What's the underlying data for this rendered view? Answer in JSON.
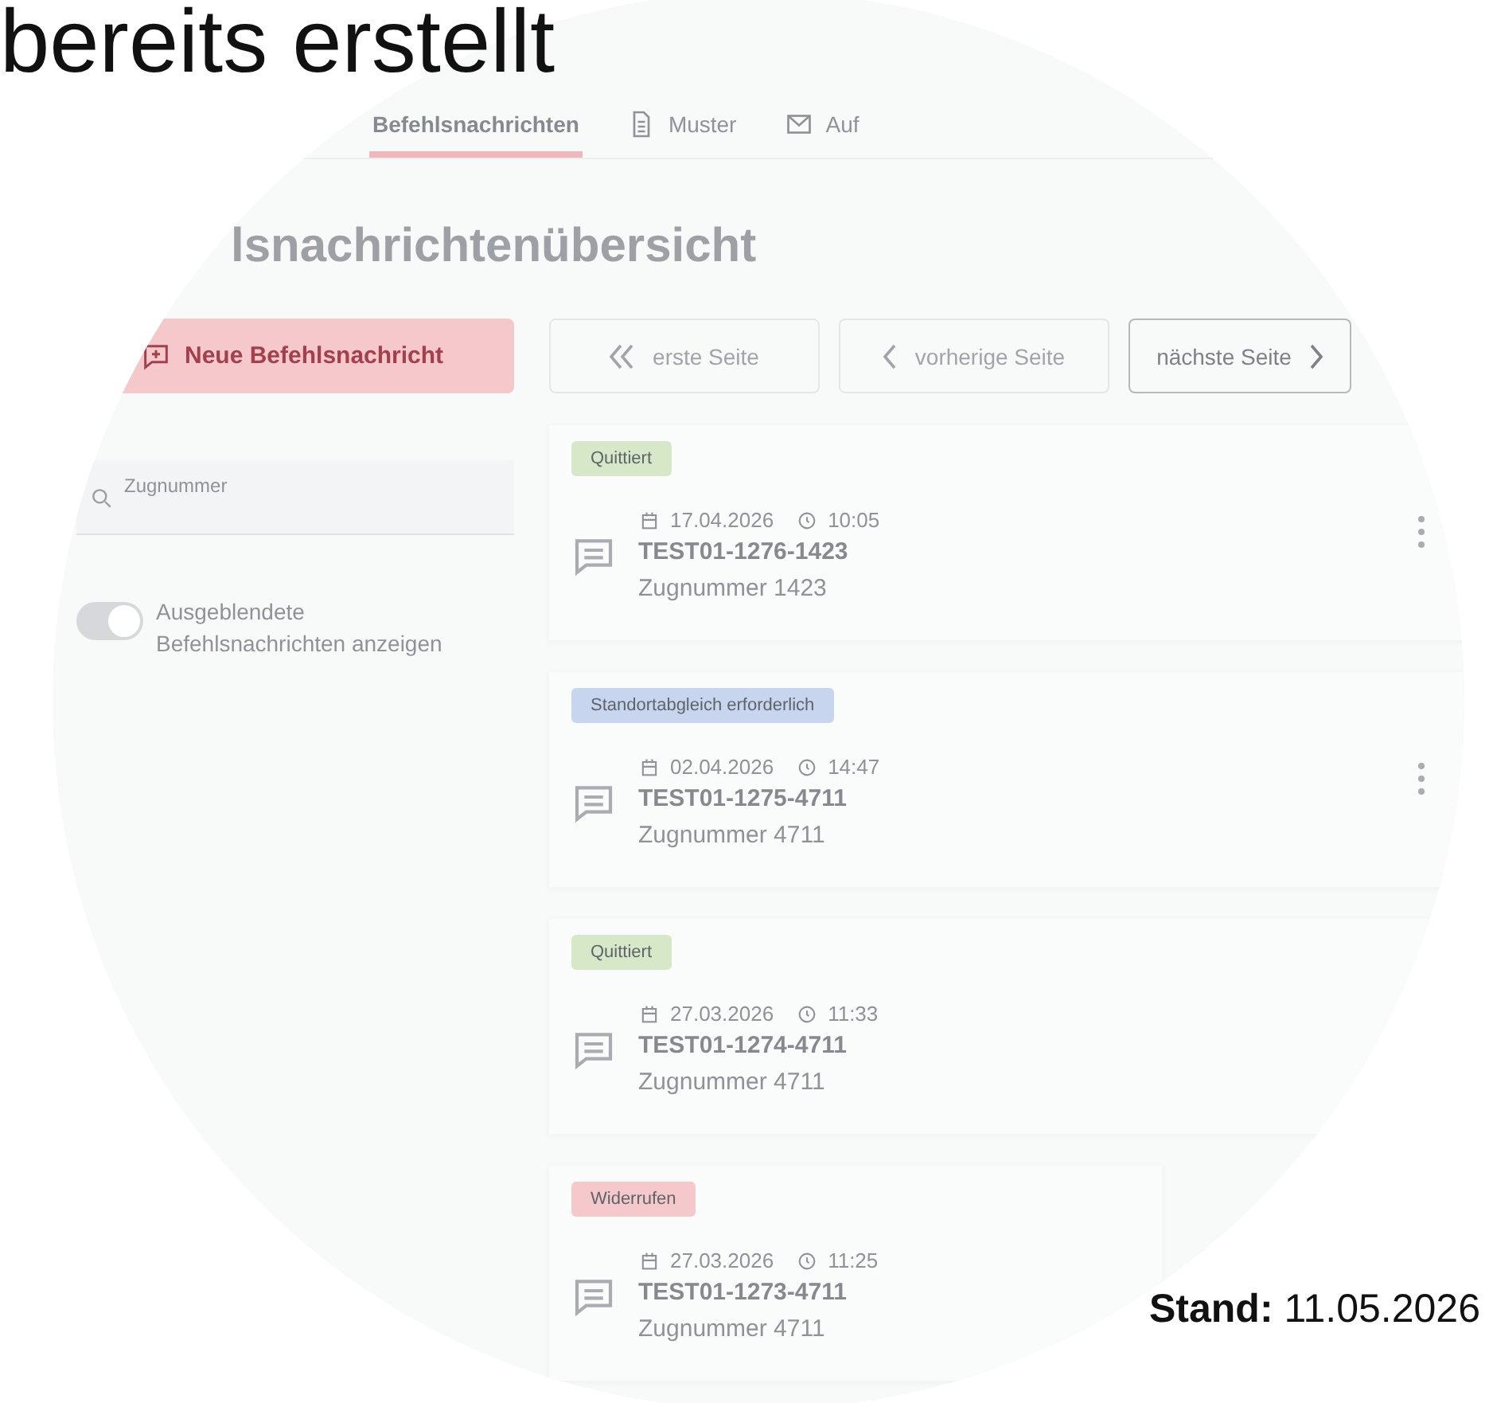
{
  "slide": {
    "title": "bereits erstellt",
    "footer": "**Stand:** 11.05.2026"
  },
  "tabs": [
    {
      "label": "Befehlsnachrichten",
      "kind": "plain",
      "selected": true
    },
    {
      "label": "Muster",
      "kind": "document",
      "selected": false
    },
    {
      "label": "Auf",
      "kind": "mail",
      "selected": false
    }
  ],
  "heading": "lsnachrichtenübersicht",
  "new_button": "Neue Befehlsnachricht",
  "search": {
    "placeholder": "Zugnummer"
  },
  "toggle": {
    "label": "Ausgeblendete Befehlsnachrichten anzeigen",
    "on": true
  },
  "pager": [
    {
      "label": "erste Seite",
      "kind": "first",
      "disabled": true
    },
    {
      "label": "vorherige Seite",
      "kind": "prev",
      "disabled": true
    },
    {
      "label": "nächste Seite",
      "kind": "next",
      "disabled": false
    }
  ],
  "messages": [
    {
      "status": "Quittiert",
      "color": "#d7e8c8",
      "date": "17.04.2026",
      "time": "10:05",
      "title": "TEST01-1276-1423",
      "subtitle": "Zugnummer 1423",
      "menu": true
    },
    {
      "status": "Standortabgleich erforderlich",
      "color": "#c7d6ee",
      "date": "02.04.2026",
      "time": "14:47",
      "title": "TEST01-1275-4711",
      "subtitle": "Zugnummer 4711",
      "menu": true
    },
    {
      "status": "Quittiert",
      "color": "#d7e8c8",
      "date": "27.03.2026",
      "time": "11:33",
      "title": "TEST01-1274-4711",
      "subtitle": "Zugnummer 4711",
      "menu": false
    },
    {
      "status": "Widerrufen",
      "color": "#f5c9cc",
      "date": "27.03.2026",
      "time": "11:25",
      "title": "TEST01-1273-4711",
      "subtitle": "Zugnummer 4711",
      "menu": false
    }
  ]
}
